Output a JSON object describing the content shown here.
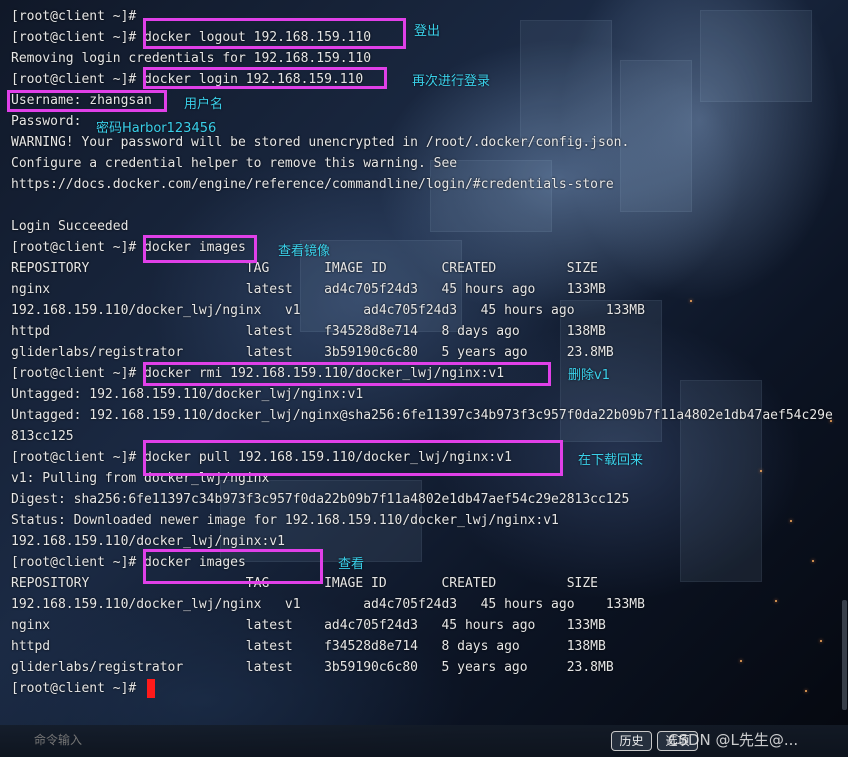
{
  "terminal": {
    "lines": [
      "[root@client ~]#",
      "[root@client ~]# docker logout 192.168.159.110",
      "Removing login credentials for 192.168.159.110",
      "[root@client ~]# docker login 192.168.159.110",
      "Username: zhangsan",
      "Password:",
      "WARNING! Your password will be stored unencrypted in /root/.docker/config.json.",
      "Configure a credential helper to remove this warning. See",
      "https://docs.docker.com/engine/reference/commandline/login/#credentials-store",
      "",
      "Login Succeeded",
      "[root@client ~]# docker images",
      "REPOSITORY                    TAG       IMAGE ID       CREATED         SIZE",
      "nginx                         latest    ad4c705f24d3   45 hours ago    133MB",
      "192.168.159.110/docker_lwj/nginx   v1        ad4c705f24d3   45 hours ago    133MB",
      "httpd                         latest    f34528d8e714   8 days ago      138MB",
      "gliderlabs/registrator        latest    3b59190c6c80   5 years ago     23.8MB",
      "[root@client ~]# docker rmi 192.168.159.110/docker_lwj/nginx:v1",
      "Untagged: 192.168.159.110/docker_lwj/nginx:v1",
      "Untagged: 192.168.159.110/docker_lwj/nginx@sha256:6fe11397c34b973f3c957f0da22b09b7f11a4802e1db47aef54c29e",
      "813cc125",
      "[root@client ~]# docker pull 192.168.159.110/docker_lwj/nginx:v1",
      "v1: Pulling from docker_lwj/nginx",
      "Digest: sha256:6fe11397c34b973f3c957f0da22b09b7f11a4802e1db47aef54c29e2813cc125",
      "Status: Downloaded newer image for 192.168.159.110/docker_lwj/nginx:v1",
      "192.168.159.110/docker_lwj/nginx:v1",
      "[root@client ~]# docker images",
      "REPOSITORY                    TAG       IMAGE ID       CREATED         SIZE",
      "192.168.159.110/docker_lwj/nginx   v1        ad4c705f24d3   45 hours ago    133MB",
      "nginx                         latest    ad4c705f24d3   45 hours ago    133MB",
      "httpd                         latest    f34528d8e714   8 days ago      138MB",
      "gliderlabs/registrator        latest    3b59190c6c80   5 years ago     23.8MB",
      "[root@client ~]#"
    ]
  },
  "annotations": {
    "logout_note": "登出",
    "relogin_note": "再次进行登录",
    "username_note": "用户名",
    "password_note": "密码Harbor123456",
    "images_note": "查看镜像",
    "rmi_note": "删除v1",
    "pull_note": "在下载回来",
    "images2_note": "查看"
  },
  "bottom_bar": {
    "command_input_placeholder": "命令输入",
    "history_button": "历史",
    "options_button": "选项",
    "watermark": "CSDN @L先生@..."
  },
  "colors": {
    "highlight_box": "#e040e8",
    "annotation_text": "#3ad0ea",
    "cursor": "#ff1a1a",
    "terminal_text": "#e6e6e6"
  }
}
